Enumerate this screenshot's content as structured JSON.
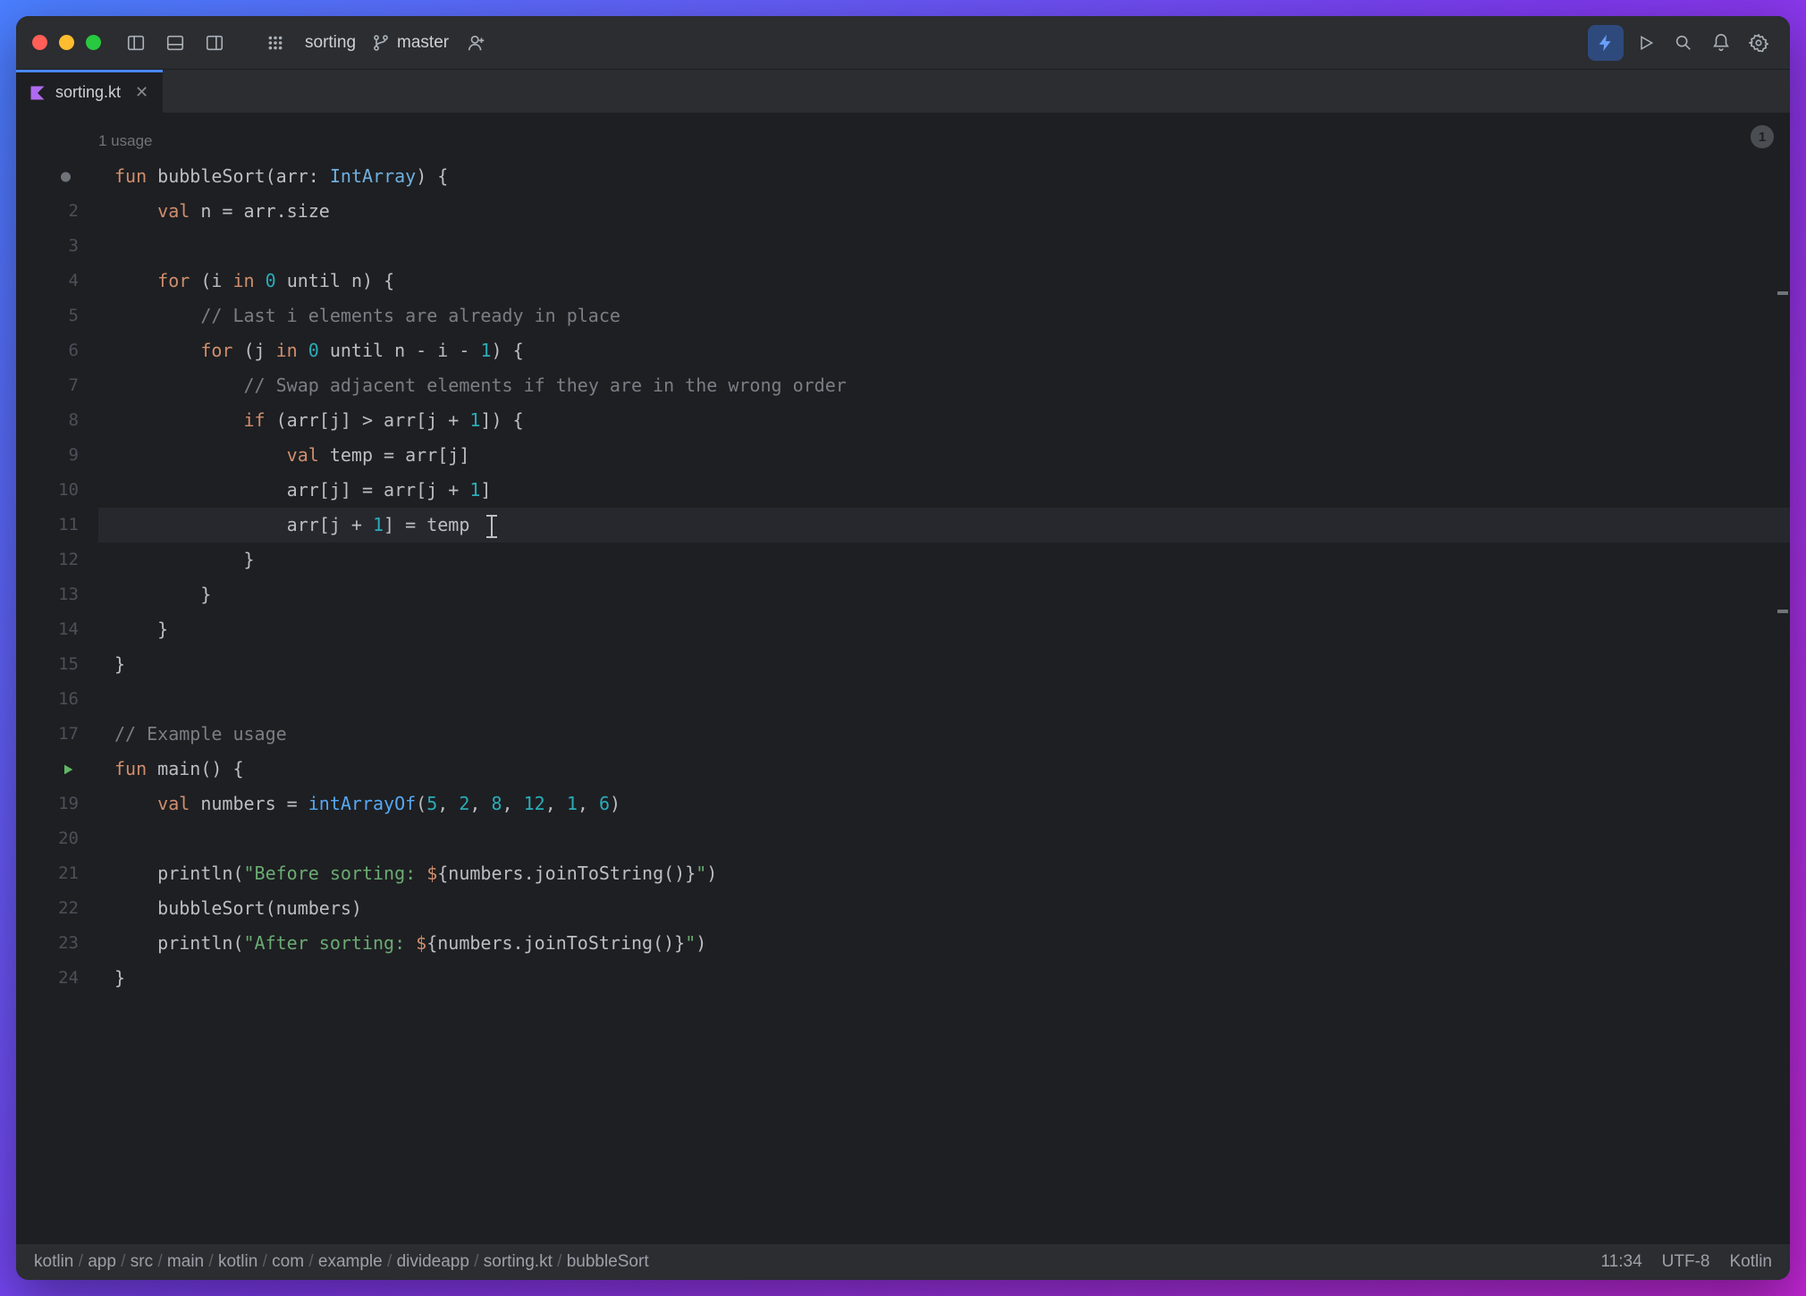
{
  "project": "sorting",
  "branch": "master",
  "tab": {
    "filename": "sorting.kt"
  },
  "usages_hint": "1 usage",
  "problems_count": "1",
  "code_lines": [
    {
      "n": "",
      "marker": "dot",
      "tokens": [
        [
          "kw",
          "fun"
        ],
        [
          "op",
          " "
        ],
        [
          "fndef",
          "bubbleSort"
        ],
        [
          "op",
          "("
        ],
        [
          "op",
          "arr: "
        ],
        [
          "type",
          "IntArray"
        ],
        [
          "op",
          ") {"
        ]
      ]
    },
    {
      "n": "2",
      "tokens": [
        [
          "op",
          "    "
        ],
        [
          "kw",
          "val"
        ],
        [
          "op",
          " n = arr.size"
        ]
      ]
    },
    {
      "n": "3",
      "tokens": [
        [
          "op",
          ""
        ]
      ]
    },
    {
      "n": "4",
      "tokens": [
        [
          "op",
          "    "
        ],
        [
          "kw",
          "for"
        ],
        [
          "op",
          " (i "
        ],
        [
          "kw",
          "in"
        ],
        [
          "op",
          " "
        ],
        [
          "num",
          "0"
        ],
        [
          "op",
          " until n) {"
        ]
      ]
    },
    {
      "n": "5",
      "tokens": [
        [
          "op",
          "        "
        ],
        [
          "cmt",
          "// Last i elements are already in place"
        ]
      ]
    },
    {
      "n": "6",
      "tokens": [
        [
          "op",
          "        "
        ],
        [
          "kw",
          "for"
        ],
        [
          "op",
          " (j "
        ],
        [
          "kw",
          "in"
        ],
        [
          "op",
          " "
        ],
        [
          "num",
          "0"
        ],
        [
          "op",
          " until n - i - "
        ],
        [
          "num",
          "1"
        ],
        [
          "op",
          ") {"
        ]
      ]
    },
    {
      "n": "7",
      "tokens": [
        [
          "op",
          "            "
        ],
        [
          "cmt",
          "// Swap adjacent elements if they are in the wrong order"
        ]
      ]
    },
    {
      "n": "8",
      "tokens": [
        [
          "op",
          "            "
        ],
        [
          "kw",
          "if"
        ],
        [
          "op",
          " (arr[j] > arr[j + "
        ],
        [
          "num",
          "1"
        ],
        [
          "op",
          "]) {"
        ]
      ]
    },
    {
      "n": "9",
      "tokens": [
        [
          "op",
          "                "
        ],
        [
          "kw",
          "val"
        ],
        [
          "op",
          " temp = arr[j]"
        ]
      ]
    },
    {
      "n": "10",
      "tokens": [
        [
          "op",
          "                arr[j] = arr[j + "
        ],
        [
          "num",
          "1"
        ],
        [
          "op",
          "]"
        ]
      ]
    },
    {
      "n": "11",
      "current": true,
      "tokens": [
        [
          "op",
          "                arr[j + "
        ],
        [
          "num",
          "1"
        ],
        [
          "op",
          "] = temp"
        ]
      ]
    },
    {
      "n": "12",
      "tokens": [
        [
          "op",
          "            }"
        ]
      ]
    },
    {
      "n": "13",
      "tokens": [
        [
          "op",
          "        }"
        ]
      ]
    },
    {
      "n": "14",
      "tokens": [
        [
          "op",
          "    }"
        ]
      ]
    },
    {
      "n": "15",
      "tokens": [
        [
          "op",
          "}"
        ]
      ]
    },
    {
      "n": "16",
      "tokens": [
        [
          "op",
          ""
        ]
      ]
    },
    {
      "n": "17",
      "tokens": [
        [
          "cmt",
          "// Example usage"
        ]
      ]
    },
    {
      "n": "",
      "marker": "play",
      "tokens": [
        [
          "kw",
          "fun"
        ],
        [
          "op",
          " "
        ],
        [
          "fndef",
          "main"
        ],
        [
          "op",
          "() {"
        ]
      ]
    },
    {
      "n": "19",
      "tokens": [
        [
          "op",
          "    "
        ],
        [
          "kw",
          "val"
        ],
        [
          "op",
          " numbers = "
        ],
        [
          "fn",
          "intArrayOf"
        ],
        [
          "op",
          "("
        ],
        [
          "num",
          "5"
        ],
        [
          "op",
          ", "
        ],
        [
          "num",
          "2"
        ],
        [
          "op",
          ", "
        ],
        [
          "num",
          "8"
        ],
        [
          "op",
          ", "
        ],
        [
          "num",
          "12"
        ],
        [
          "op",
          ", "
        ],
        [
          "num",
          "1"
        ],
        [
          "op",
          ", "
        ],
        [
          "num",
          "6"
        ],
        [
          "op",
          ")"
        ]
      ]
    },
    {
      "n": "20",
      "tokens": [
        [
          "op",
          ""
        ]
      ]
    },
    {
      "n": "21",
      "tokens": [
        [
          "op",
          "    println("
        ],
        [
          "str",
          "\"Before sorting: "
        ],
        [
          "tmpl",
          "$"
        ],
        [
          "op",
          "{numbers.joinToString()}"
        ],
        [
          "str",
          "\""
        ],
        [
          "op",
          ")"
        ]
      ]
    },
    {
      "n": "22",
      "tokens": [
        [
          "op",
          "    bubbleSort(numbers)"
        ]
      ]
    },
    {
      "n": "23",
      "tokens": [
        [
          "op",
          "    println("
        ],
        [
          "str",
          "\"After sorting: "
        ],
        [
          "tmpl",
          "$"
        ],
        [
          "op",
          "{numbers.joinToString()}"
        ],
        [
          "str",
          "\""
        ],
        [
          "op",
          ")"
        ]
      ]
    },
    {
      "n": "24",
      "tokens": [
        [
          "op",
          "}"
        ]
      ]
    }
  ],
  "breadcrumbs": [
    "kotlin",
    "app",
    "src",
    "main",
    "kotlin",
    "com",
    "example",
    "divideapp",
    "sorting.kt",
    "bubbleSort"
  ],
  "status": {
    "position": "11:34",
    "encoding": "UTF-8",
    "language": "Kotlin"
  }
}
